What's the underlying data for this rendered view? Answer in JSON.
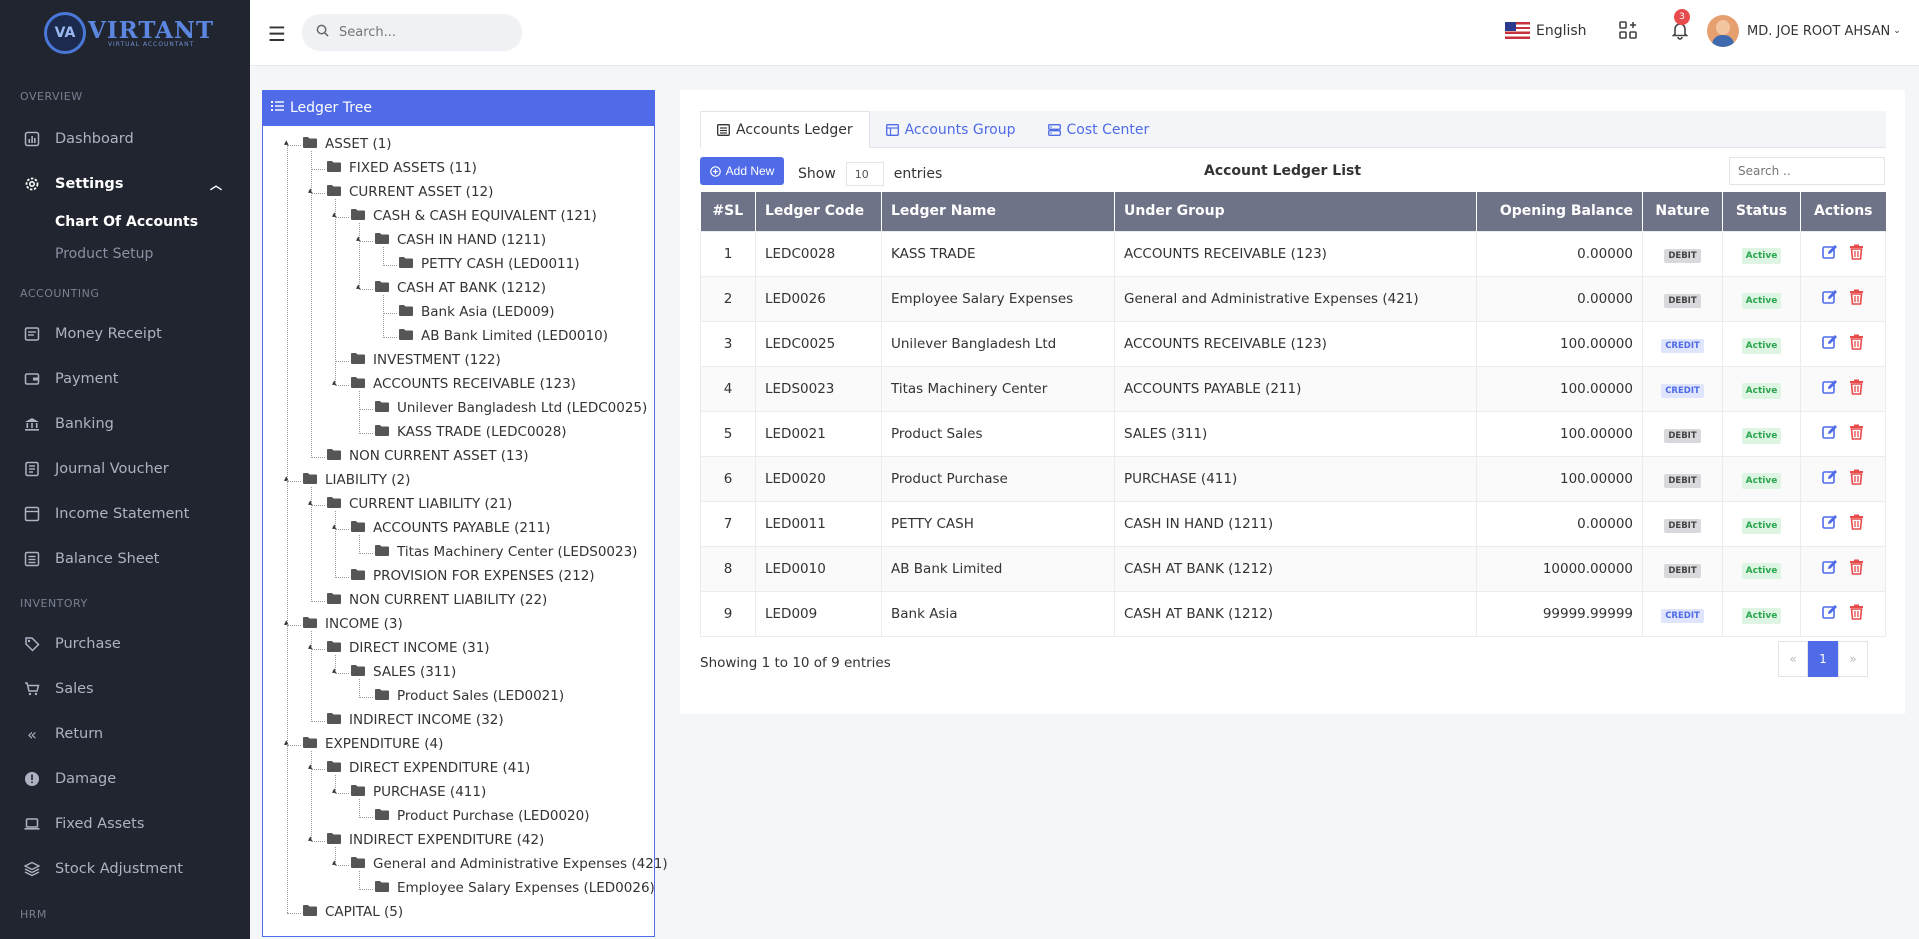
{
  "brand": {
    "name": "VIRTANT",
    "tagline": "VIRTUAL ACCOUNTANT",
    "mark": "VA"
  },
  "sidebar": {
    "sections": [
      {
        "label": "OVERVIEW"
      },
      {
        "label": "ACCOUNTING"
      },
      {
        "label": "INVENTORY"
      },
      {
        "label": "HRM"
      }
    ],
    "items": [
      {
        "label": "Dashboard",
        "icon": "chart-bar-icon"
      },
      {
        "label": "Settings",
        "icon": "gear-icon",
        "expanded": true
      },
      {
        "label": "Money Receipt",
        "icon": "receipt-icon"
      },
      {
        "label": "Payment",
        "icon": "wallet-icon"
      },
      {
        "label": "Banking",
        "icon": "bank-icon"
      },
      {
        "label": "Journal Voucher",
        "icon": "journal-icon"
      },
      {
        "label": "Income Statement",
        "icon": "statement-icon"
      },
      {
        "label": "Balance Sheet",
        "icon": "sheet-icon"
      },
      {
        "label": "Purchase",
        "icon": "tag-icon"
      },
      {
        "label": "Sales",
        "icon": "cart-icon"
      },
      {
        "label": "Return",
        "icon": "double-chevron-left-icon"
      },
      {
        "label": "Damage",
        "icon": "alert-circle-icon"
      },
      {
        "label": "Fixed Assets",
        "icon": "laptop-icon"
      },
      {
        "label": "Stock Adjustment",
        "icon": "layers-icon"
      }
    ],
    "subitems": [
      {
        "label": "Chart Of Accounts",
        "active": true
      },
      {
        "label": "Product Setup",
        "active": false
      }
    ]
  },
  "header": {
    "search_placeholder": "Search...",
    "language": "English",
    "notification_count": "3",
    "user_name": "MD. JOE ROOT AHSAN"
  },
  "tree": {
    "title": "Ledger Tree",
    "nodes": [
      {
        "label": "ASSET (1)",
        "level": 0,
        "toggle": true
      },
      {
        "label": "FIXED ASSETS (11)",
        "level": 1,
        "toggle": false
      },
      {
        "label": "CURRENT ASSET (12)",
        "level": 1,
        "toggle": true
      },
      {
        "label": "CASH & CASH EQUIVALENT (121)",
        "level": 2,
        "toggle": true
      },
      {
        "label": "CASH IN HAND (1211)",
        "level": 3,
        "toggle": true
      },
      {
        "label": "PETTY CASH (LED0011)",
        "level": 4,
        "toggle": false
      },
      {
        "label": "CASH AT BANK (1212)",
        "level": 3,
        "toggle": true
      },
      {
        "label": "Bank Asia (LED009)",
        "level": 4,
        "toggle": false
      },
      {
        "label": "AB Bank Limited (LED0010)",
        "level": 4,
        "toggle": false
      },
      {
        "label": "INVESTMENT (122)",
        "level": 2,
        "toggle": false
      },
      {
        "label": "ACCOUNTS RECEIVABLE (123)",
        "level": 2,
        "toggle": true
      },
      {
        "label": "Unilever Bangladesh Ltd (LEDC0025)",
        "level": 3,
        "toggle": false
      },
      {
        "label": "KASS TRADE (LEDC0028)",
        "level": 3,
        "toggle": false
      },
      {
        "label": "NON CURRENT ASSET (13)",
        "level": 1,
        "toggle": false
      },
      {
        "label": "LIABILITY (2)",
        "level": 0,
        "toggle": true
      },
      {
        "label": "CURRENT LIABILITY (21)",
        "level": 1,
        "toggle": true
      },
      {
        "label": "ACCOUNTS PAYABLE (211)",
        "level": 2,
        "toggle": true
      },
      {
        "label": "Titas Machinery Center (LEDS0023)",
        "level": 3,
        "toggle": false
      },
      {
        "label": "PROVISION FOR EXPENSES (212)",
        "level": 2,
        "toggle": false
      },
      {
        "label": "NON CURRENT LIABILITY (22)",
        "level": 1,
        "toggle": false
      },
      {
        "label": "INCOME (3)",
        "level": 0,
        "toggle": true
      },
      {
        "label": "DIRECT INCOME (31)",
        "level": 1,
        "toggle": true
      },
      {
        "label": "SALES (311)",
        "level": 2,
        "toggle": true
      },
      {
        "label": "Product Sales (LED0021)",
        "level": 3,
        "toggle": false
      },
      {
        "label": "INDIRECT INCOME (32)",
        "level": 1,
        "toggle": false
      },
      {
        "label": "EXPENDITURE (4)",
        "level": 0,
        "toggle": true
      },
      {
        "label": "DIRECT EXPENDITURE (41)",
        "level": 1,
        "toggle": true
      },
      {
        "label": "PURCHASE (411)",
        "level": 2,
        "toggle": true
      },
      {
        "label": "Product Purchase (LED0020)",
        "level": 3,
        "toggle": false
      },
      {
        "label": "INDIRECT EXPENDITURE (42)",
        "level": 1,
        "toggle": true
      },
      {
        "label": "General and Administrative Expenses (421)",
        "level": 2,
        "toggle": true
      },
      {
        "label": "Employee Salary Expenses (LED0026)",
        "level": 3,
        "toggle": false
      },
      {
        "label": "CAPITAL (5)",
        "level": 0,
        "toggle": false
      }
    ]
  },
  "tabs": [
    {
      "label": "Accounts Ledger",
      "icon": "list-icon",
      "active": true
    },
    {
      "label": "Accounts Group",
      "icon": "table-icon",
      "active": false
    },
    {
      "label": "Cost Center",
      "icon": "server-icon",
      "active": false
    }
  ],
  "list": {
    "add_new": "Add New",
    "show_label": "Show",
    "show_value": "10",
    "entries_label": "entries",
    "title": "Account Ledger List",
    "search_placeholder": "Search ..",
    "columns": [
      "#SL",
      "Ledger Code",
      "Ledger Name",
      "Under Group",
      "Opening Balance",
      "Nature",
      "Status",
      "Actions"
    ],
    "rows": [
      {
        "sl": "1",
        "code": "LEDC0028",
        "name": "KASS TRADE",
        "group": "ACCOUNTS RECEIVABLE (123)",
        "balance": "0.00000",
        "nature": "DEBIT",
        "status": "Active"
      },
      {
        "sl": "2",
        "code": "LED0026",
        "name": "Employee Salary Expenses",
        "group": "General and Administrative Expenses (421)",
        "balance": "0.00000",
        "nature": "DEBIT",
        "status": "Active"
      },
      {
        "sl": "3",
        "code": "LEDC0025",
        "name": "Unilever Bangladesh Ltd",
        "group": "ACCOUNTS RECEIVABLE (123)",
        "balance": "100.00000",
        "nature": "CREDIT",
        "status": "Active"
      },
      {
        "sl": "4",
        "code": "LEDS0023",
        "name": "Titas Machinery Center",
        "group": "ACCOUNTS PAYABLE (211)",
        "balance": "100.00000",
        "nature": "CREDIT",
        "status": "Active"
      },
      {
        "sl": "5",
        "code": "LED0021",
        "name": "Product Sales",
        "group": "SALES (311)",
        "balance": "100.00000",
        "nature": "DEBIT",
        "status": "Active"
      },
      {
        "sl": "6",
        "code": "LED0020",
        "name": "Product Purchase",
        "group": "PURCHASE (411)",
        "balance": "100.00000",
        "nature": "DEBIT",
        "status": "Active"
      },
      {
        "sl": "7",
        "code": "LED0011",
        "name": "PETTY CASH",
        "group": "CASH IN HAND (1211)",
        "balance": "0.00000",
        "nature": "DEBIT",
        "status": "Active"
      },
      {
        "sl": "8",
        "code": "LED0010",
        "name": "AB Bank Limited",
        "group": "CASH AT BANK (1212)",
        "balance": "10000.00000",
        "nature": "DEBIT",
        "status": "Active"
      },
      {
        "sl": "9",
        "code": "LED009",
        "name": "Bank Asia",
        "group": "CASH AT BANK (1212)",
        "balance": "99999.99999",
        "nature": "CREDIT",
        "status": "Active"
      }
    ],
    "showing": "Showing 1 to 10 of 9 entries",
    "pager": {
      "prev": "«",
      "current": "1",
      "next": "»"
    }
  },
  "colors": {
    "accent": "#4f6be8",
    "sidebar_bg": "#212530",
    "table_head": "#6f7387",
    "danger": "#e84b4b",
    "success": "#2ba64d"
  }
}
